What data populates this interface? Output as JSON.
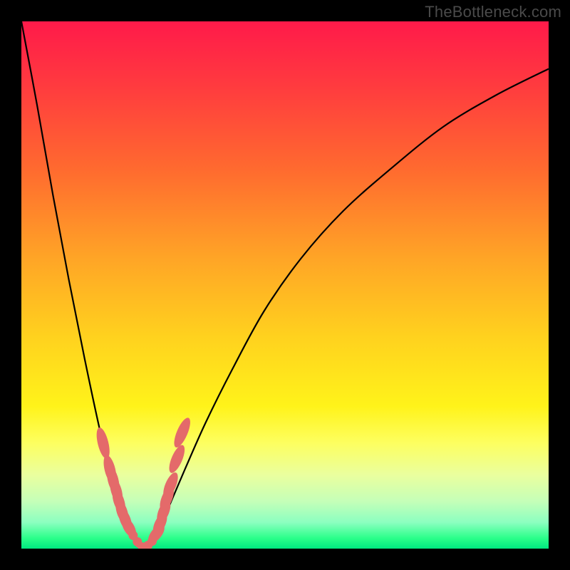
{
  "watermark": "TheBottleneck.com",
  "colors": {
    "frame": "#000000",
    "spot": "#e46a6a",
    "curve": "#000000"
  },
  "chart_data": {
    "type": "line",
    "title": "",
    "xlabel": "",
    "ylabel": "",
    "xlim": [
      0,
      100
    ],
    "ylim": [
      0,
      100
    ],
    "grid": false,
    "legend": false,
    "notes": "V-shaped bottleneck curve on rainbow gradient background; axes have no visible tick labels in the source. Series values are estimated from the plotted curve height (0 = bottom/green, 100 = top/red). Minimum (optimal match) is around x≈23.",
    "series": [
      {
        "name": "bottleneck-curve",
        "x": [
          0,
          3,
          6,
          9,
          12,
          15,
          18,
          20,
          22,
          23,
          24,
          26,
          28,
          31,
          35,
          40,
          46,
          53,
          61,
          70,
          80,
          90,
          100
        ],
        "values": [
          100,
          84,
          67,
          51,
          36,
          22,
          10,
          4,
          1,
          0,
          1,
          3,
          8,
          15,
          24,
          34,
          45,
          55,
          64,
          72,
          80,
          86,
          91
        ]
      }
    ],
    "highlight_points": {
      "name": "benchmark-dots",
      "note": "pink sample markers clustered near the curve minimum",
      "x": [
        15.5,
        16.8,
        17.4,
        18.0,
        18.5,
        19.1,
        19.7,
        20.4,
        21.2,
        22.0,
        23.0,
        24.0,
        24.8,
        25.6,
        26.3,
        27.0,
        27.6,
        28.3,
        29.5,
        30.5
      ],
      "values": [
        20,
        15,
        13,
        11,
        9,
        7,
        5.5,
        4,
        2.5,
        1.3,
        0.3,
        0.6,
        1.4,
        2.8,
        4.7,
        7,
        9.5,
        12,
        17,
        22
      ]
    }
  }
}
